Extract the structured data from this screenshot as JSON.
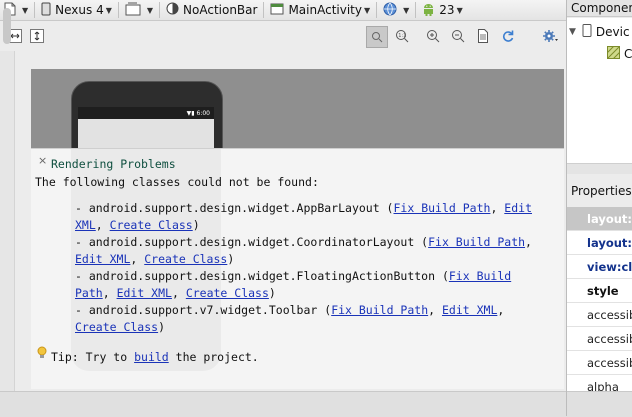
{
  "toolbar": {
    "device": "Nexus 4",
    "theme": "NoActionBar",
    "activity": "MainActivity",
    "api_level": "23"
  },
  "preview": {
    "status_time": "6:00"
  },
  "problems": {
    "close_glyph": "×",
    "title": "Rendering Problems",
    "intro": "The following classes could not be found:",
    "classes": [
      {
        "prefix": "- android.support.design.widget.AppBarLayout (",
        "fix": "Fix Build Path",
        "sep1": ", ",
        "edit_a": "Edit",
        "edit_b": "XML",
        "sep2": ", ",
        "create": "Create Class",
        "suffix": ")"
      },
      {
        "prefix": "- android.support.design.widget.CoordinatorLayout (",
        "fix": "Fix Build Path",
        "sep1": ",",
        "edit": "Edit XML",
        "sep2": ", ",
        "create": "Create Class",
        "suffix": ")"
      },
      {
        "prefix": "- android.support.design.widget.FloatingActionButton (",
        "fix_a": "Fix Build",
        "fix_b": "Path",
        "sep1": ", ",
        "edit": "Edit XML",
        "sep2": ", ",
        "create": "Create Class",
        "suffix": ")"
      },
      {
        "prefix": "- android.support.v7.widget.Toolbar (",
        "fix": "Fix Build Path",
        "sep1": ", ",
        "edit": "Edit XML",
        "sep2": ",",
        "create": "Create Class",
        "suffix": ")"
      }
    ],
    "tip_prefix": "Tip: Try to ",
    "tip_link": "build",
    "tip_suffix": " the project."
  },
  "component_tree": {
    "title": "Component",
    "rows": [
      "Devic",
      "C"
    ]
  },
  "properties": {
    "title": "Properties",
    "rows": [
      {
        "label": "layout:w",
        "style": "selected"
      },
      {
        "label": "layout:h",
        "style": "blue"
      },
      {
        "label": "view:cla",
        "style": "blue"
      },
      {
        "label": "style",
        "style": "bold"
      },
      {
        "label": "accessib",
        "style": "normal"
      },
      {
        "label": "accessib",
        "style": "normal"
      },
      {
        "label": "accessib",
        "style": "normal"
      },
      {
        "label": "alpha",
        "style": "normal"
      }
    ]
  },
  "colors": {
    "link": "#1a33b8",
    "title_green": "#0f4f3f",
    "selected_row": "#c6c6c6",
    "property_blue": "#13328c"
  }
}
